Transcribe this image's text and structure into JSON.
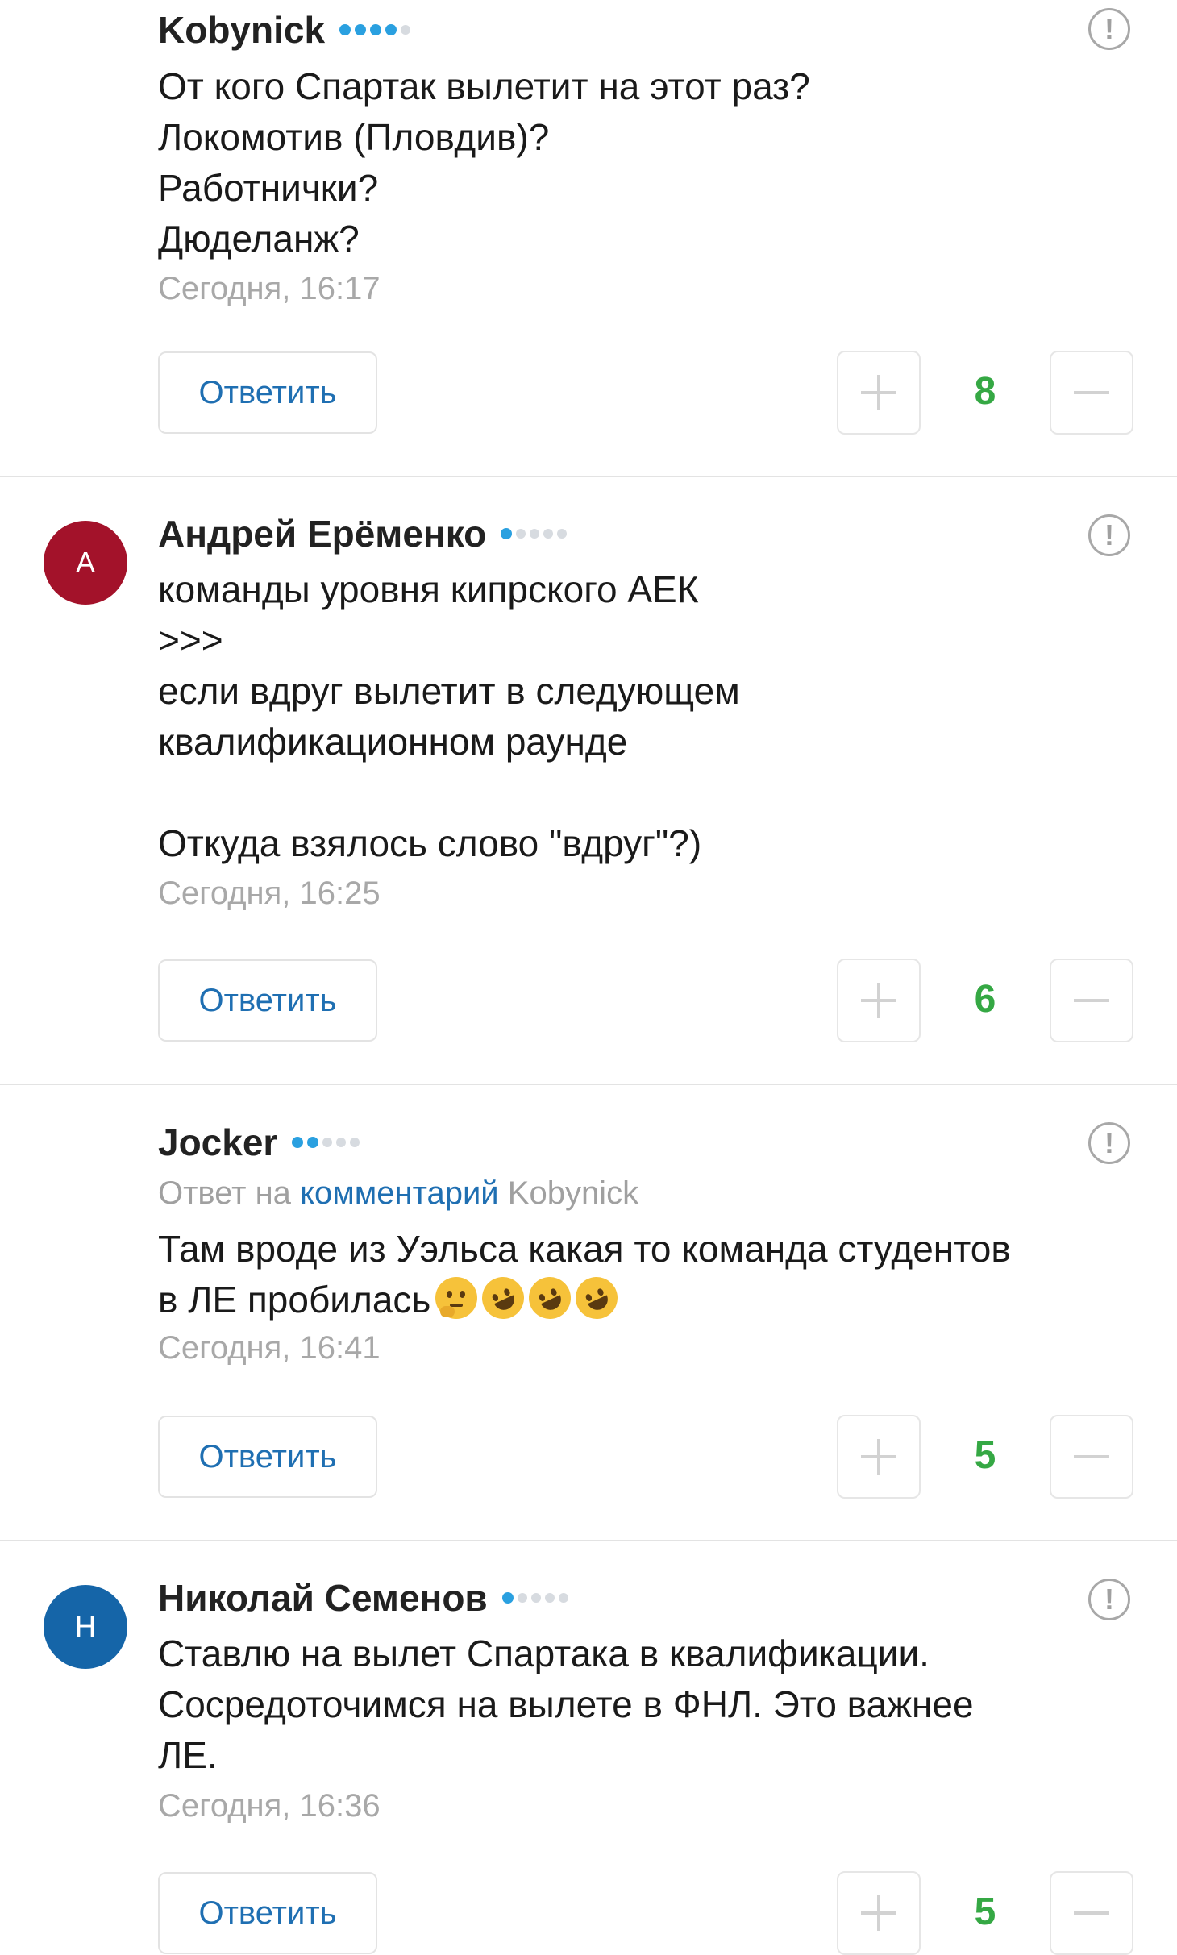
{
  "ui": {
    "reply_label": "Ответить",
    "report_icon_glyph": "!",
    "plus_icon": "plus-icon",
    "minus_icon": "minus-icon"
  },
  "colors": {
    "link": "#1f6fb2",
    "score": "#35a844",
    "rank_active": "#2aa0e0",
    "rank_inactive": "#d7dbe0"
  },
  "comments": [
    {
      "author": "Kobynick",
      "rank_active": 4,
      "rank_total": 5,
      "text": "От кого Спартак вылетит на этот раз?\nЛокомотив (Пловдив)?\nРаботнички?\nДюделанж?",
      "time": "Сегодня, 16:17",
      "score": "8"
    },
    {
      "author": "Андрей Ерёменко",
      "avatar_letter": "А",
      "avatar_color": "#a3122a",
      "rank_active": 1,
      "rank_total": 5,
      "text": "команды уровня кипрского АЕК\n>>>\nесли вдруг вылетит в следующем\nквалификационном раунде\n\nОткуда взялось слово \"вдруг\"?)",
      "time": "Сегодня, 16:25",
      "score": "6"
    },
    {
      "author": "Jocker",
      "rank_active": 2,
      "rank_total": 5,
      "reply_prefix": "Ответ на",
      "reply_link": "комментарий",
      "reply_user": "Kobynick",
      "text": "Там вроде из Уэльса какая то команда студентов\nв ЛЕ пробилась",
      "emojis": [
        "thinking-face-emoji",
        "rofl-emoji",
        "rofl-emoji",
        "rofl-emoji"
      ],
      "time": "Сегодня, 16:41",
      "score": "5"
    },
    {
      "author": "Николай Семенов",
      "avatar_letter": "Н",
      "avatar_color": "#1565a8",
      "rank_active": 1,
      "rank_total": 5,
      "text": "Ставлю на вылет Спартака в квалификации.\nСосредоточимся на вылете в ФНЛ. Это важнее\nЛЕ.",
      "time": "Сегодня, 16:36",
      "score": "5"
    }
  ]
}
